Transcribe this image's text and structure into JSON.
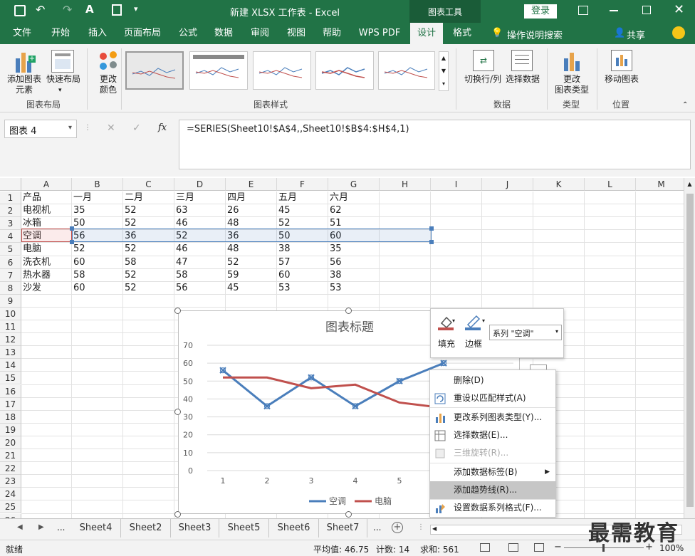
{
  "titlebar": {
    "title": "新建 XLSX 工作表  -  Excel",
    "context_tab": "图表工具",
    "login": "登录"
  },
  "tabs": [
    "文件",
    "开始",
    "插入",
    "页面布局",
    "公式",
    "数据",
    "审阅",
    "视图",
    "帮助",
    "WPS PDF",
    "设计",
    "格式"
  ],
  "tell_me": "操作说明搜索",
  "share": "共享",
  "ribbon": {
    "add_element": "添加图表\n元素",
    "quick_layout": "快速布局",
    "change_color": "更改\n颜色",
    "group_layout": "图表布局",
    "group_styles": "图表样式",
    "switch_rowcol": "切换行/列",
    "select_data": "选择数据",
    "group_data": "数据",
    "change_type": "更改\n图表类型",
    "group_type": "类型",
    "move_chart": "移动图表",
    "group_location": "位置"
  },
  "formula_bar": {
    "name_box": "图表 4",
    "fx": "fx",
    "formula": "=SERIES(Sheet10!$A$4,,Sheet10!$B$4:$H$4,1)"
  },
  "columns": [
    "A",
    "B",
    "C",
    "D",
    "E",
    "F",
    "G",
    "H",
    "I",
    "J",
    "K",
    "L",
    "M"
  ],
  "rows": [
    "1",
    "2",
    "3",
    "4",
    "5",
    "6",
    "7",
    "8",
    "9",
    "10",
    "11",
    "12",
    "13",
    "14",
    "15",
    "16",
    "17",
    "18",
    "19",
    "20",
    "21",
    "22",
    "23",
    "24",
    "25",
    "26"
  ],
  "table": [
    [
      "产品",
      "一月",
      "二月",
      "三月",
      "四月",
      "五月",
      "六月"
    ],
    [
      "电视机",
      "35",
      "52",
      "63",
      "26",
      "45",
      "62"
    ],
    [
      "冰箱",
      "50",
      "52",
      "46",
      "48",
      "52",
      "51"
    ],
    [
      "空调",
      "56",
      "36",
      "52",
      "36",
      "50",
      "60"
    ],
    [
      "电脑",
      "52",
      "52",
      "46",
      "48",
      "38",
      "35"
    ],
    [
      "洗衣机",
      "60",
      "58",
      "47",
      "52",
      "57",
      "56"
    ],
    [
      "热水器",
      "58",
      "52",
      "58",
      "59",
      "60",
      "38"
    ],
    [
      "沙发",
      "60",
      "52",
      "56",
      "45",
      "53",
      "53"
    ]
  ],
  "chart_data": {
    "type": "line",
    "title": "图表标题",
    "x": [
      1,
      2,
      3,
      4,
      5,
      6
    ],
    "ylim": [
      0,
      70
    ],
    "yticks": [
      "0",
      "10",
      "20",
      "30",
      "40",
      "50",
      "60",
      "70"
    ],
    "xticks": [
      "1",
      "2",
      "3",
      "4",
      "5"
    ],
    "series": [
      {
        "name": "空调",
        "values": [
          56,
          36,
          52,
          36,
          50,
          60
        ],
        "color": "#4a7ebb"
      },
      {
        "name": "电脑",
        "values": [
          52,
          52,
          46,
          48,
          38,
          35
        ],
        "color": "#c0504d"
      }
    ],
    "legend": "bottom"
  },
  "mini_toolbar": {
    "fill": "填充",
    "border": "边框",
    "series_select": "系列 \"空调\""
  },
  "context_menu": [
    {
      "label": "删除(D)",
      "icon": "none",
      "enabled": true
    },
    {
      "label": "重设以匹配样式(A)",
      "icon": "reset-icon",
      "enabled": true
    },
    {
      "label": "更改系列图表类型(Y)...",
      "icon": "chart-type-icon",
      "enabled": true
    },
    {
      "label": "选择数据(E)...",
      "icon": "select-data-icon",
      "enabled": true
    },
    {
      "label": "三维旋转(R)...",
      "icon": "rotate-3d-icon",
      "enabled": false
    },
    {
      "label": "添加数据标签(B)",
      "icon": "none",
      "enabled": true,
      "submenu": true
    },
    {
      "label": "添加趋势线(R)...",
      "icon": "none",
      "enabled": true,
      "highlighted": true
    },
    {
      "label": "设置数据系列格式(F)...",
      "icon": "format-series-icon",
      "enabled": true
    }
  ],
  "sheet_tabs": [
    "Sheet4",
    "Sheet2",
    "Sheet3",
    "Sheet5",
    "Sheet6",
    "Sheet7"
  ],
  "status": {
    "ready": "就绪",
    "average": "平均值: 46.75",
    "count": "计数: 14",
    "sum": "求和: 561",
    "zoom": "100%"
  },
  "watermark": "最需教育"
}
